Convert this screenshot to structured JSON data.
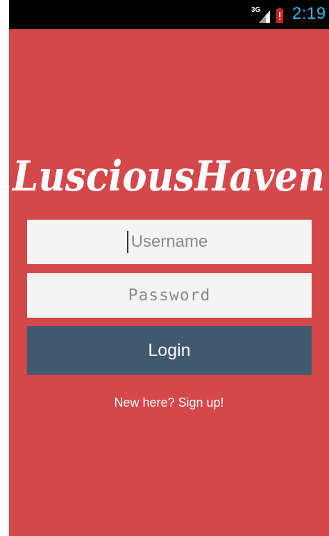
{
  "status_bar": {
    "network_label": "3G",
    "time": "2:19",
    "icons": [
      "signal-icon",
      "battery-low-icon"
    ],
    "clock_color": "#33b5e5"
  },
  "app": {
    "logo_text": "LusciousHaven",
    "background_color": "#d4474a",
    "accent_color": "#41596e"
  },
  "form": {
    "username_placeholder": "Username",
    "password_placeholder": "Password",
    "login_label": "Login",
    "signup_label": "New here? Sign up!"
  }
}
